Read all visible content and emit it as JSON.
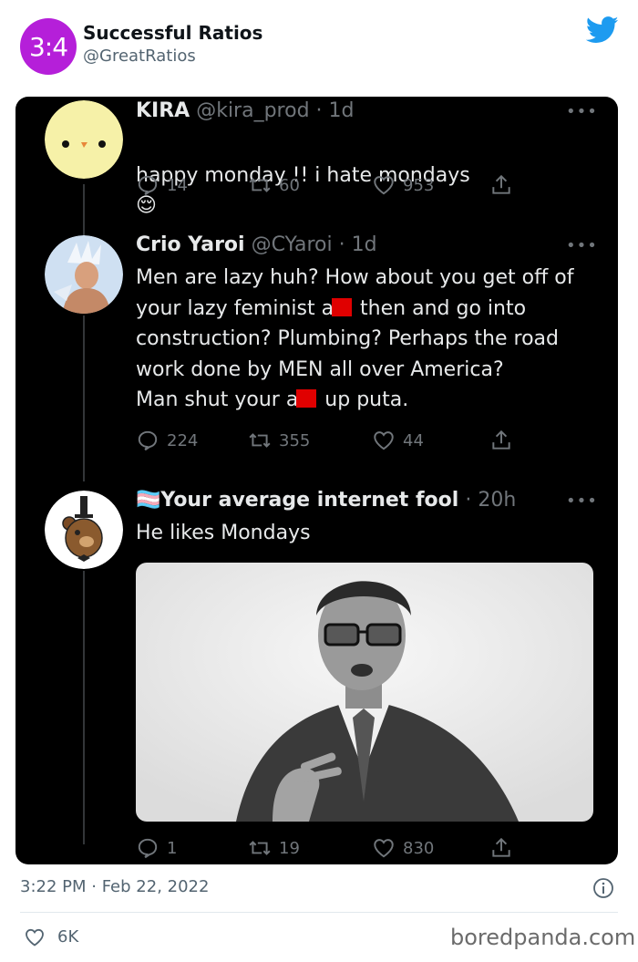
{
  "account": {
    "avatar_text": "3:4",
    "name": "Successful Ratios",
    "handle": "@GreatRatios"
  },
  "tweets": [
    {
      "name": "KIRA",
      "handle": "@kira_prod",
      "time": "1d",
      "text": "happy monday !! i hate mondays",
      "emoji": "😌",
      "replies": "14",
      "retweets": "60",
      "likes": "953"
    },
    {
      "name": "Crio Yaroi",
      "handle": "@CYaroi",
      "time": "1d",
      "text_1": "Men are lazy huh? How about you get off of\nyour lazy feminist a",
      "text_2": " then and go into\nconstruction? Plumbing? Perhaps the road\nwork done by MEN all over America?\nMan shut your a",
      "text_3": " up puta.",
      "replies": "224",
      "retweets": "355",
      "likes": "44"
    },
    {
      "flag": "🏳️‍⚧️",
      "name": "Your average internet fool",
      "time": "20h",
      "text": "He likes Mondays",
      "replies": "1",
      "retweets": "19",
      "likes": "830"
    }
  ],
  "footer": {
    "timestamp": "3:22 PM · Feb 22, 2022",
    "likes": "6K",
    "watermark": "boredpanda.com"
  },
  "colors": {
    "accent_purple": "#b51fd9",
    "twitter_blue": "#1d9bf0",
    "redaction": "#e00000"
  }
}
